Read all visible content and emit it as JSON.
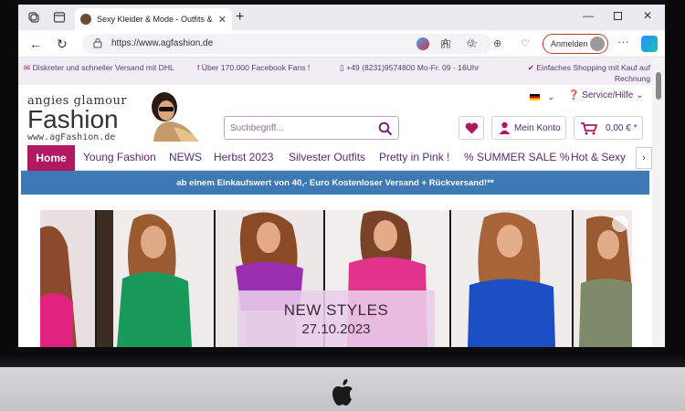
{
  "browser": {
    "tab_title": "Sexy Kleider & Mode - Outfits &",
    "url": "https://www.agfashion.de",
    "login_label": "Anmelden"
  },
  "infobar": [
    {
      "icon": "envelope-icon",
      "text": "Diskreter und schneller Versand mit DHL"
    },
    {
      "icon": "facebook-icon",
      "text": "Über 170.000 Facebook Fans !"
    },
    {
      "icon": "phone-icon",
      "text": "+49 (8231)9574800 Mo-Fr. 09 - 16Uhr"
    },
    {
      "icon": "check-icon",
      "text": "Einfaches Shopping mit Kauf auf Rechnung"
    }
  ],
  "logo": {
    "top": "angies glamour",
    "main": "Fashion",
    "sub": "www.agFashion.de"
  },
  "header": {
    "service": "Service/Hilfe",
    "search_placeholder": "Suchbegriff...",
    "account": "Mein Konto",
    "cart_total": "0,00 € *"
  },
  "menu": [
    "Home",
    "Young Fashion",
    "NEWS",
    "Herbst 2023",
    "Silvester Outfits",
    "Pretty in Pink !",
    "% SUMMER SALE %",
    "Hot & Sexy"
  ],
  "promo": "ab einem Einkaufswert von 40,- Euro Kostenloser Versand + Rückversand!**",
  "banner": {
    "title": "NEW STYLES",
    "date": "27.10.2023"
  },
  "colors": {
    "accent": "#b0185f",
    "brand": "#5a2a6a",
    "promo_bg": "#3d7ab5"
  }
}
